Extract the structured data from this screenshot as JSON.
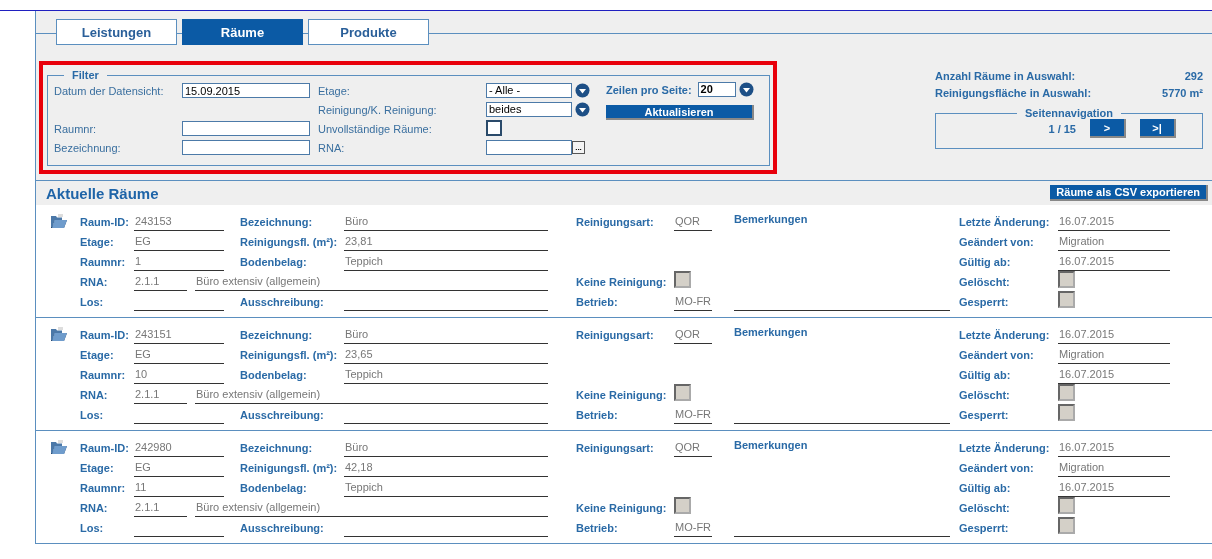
{
  "tabs": [
    {
      "label": "Leistungen",
      "selected": false
    },
    {
      "label": "Räume",
      "selected": true
    },
    {
      "label": "Produkte",
      "selected": false
    }
  ],
  "filter": {
    "legend": "Filter",
    "fields": [
      {
        "kind": "text",
        "label": "Datum der Datensicht:",
        "value": "15.09.2015"
      },
      {
        "kind": "text",
        "label": "Raumnr:"
      },
      {
        "kind": "text",
        "label": "Bezeichnung:"
      },
      {
        "kind": "select",
        "label": "Etage:",
        "value": "- Alle -"
      },
      {
        "kind": "select",
        "label": "Reinigung/K. Reinigung:",
        "value": "beides"
      },
      {
        "kind": "checkbox",
        "label": "Unvollständige Räume:",
        "checked": false
      },
      {
        "kind": "lookup",
        "label": "RNA:",
        "button": "..."
      }
    ],
    "rows_per_page": {
      "label": "Zeilen pro Seite:",
      "value": "20"
    },
    "refresh_button": "Aktualisieren"
  },
  "stats": [
    {
      "label": "Anzahl Räume in Auswahl:",
      "value": "292"
    },
    {
      "label": "Reinigungsfläche in Auswahl:",
      "value": "5770 m²"
    }
  ],
  "pagination": {
    "legend": "Seitennavigation",
    "page": "1 / 15",
    "buttons": [
      ">",
      ">|"
    ]
  },
  "section_title": "Aktuelle Räume",
  "export_button": "Räume als CSV exportieren",
  "records": [
    {
      "remarks": "Bemerkungen",
      "fields": [
        {
          "kind": "text",
          "label": "Raum-ID:",
          "value": "243153"
        },
        {
          "kind": "text",
          "label": "Bezeichnung:",
          "value": "Büro"
        },
        {
          "kind": "text",
          "label": "Reinigungsart:",
          "value": "QOR"
        },
        {
          "kind": "text",
          "label": "Letzte Änderung:",
          "value": "16.07.2015"
        },
        {
          "kind": "text",
          "label": "Etage:",
          "value": "EG"
        },
        {
          "kind": "text",
          "label": "Reinigungsfl. (m²):",
          "value": "23,81"
        },
        {
          "kind": "text",
          "label": "Geändert von:",
          "value": "Migration"
        },
        {
          "kind": "text",
          "label": "Raumnr:",
          "value": "1"
        },
        {
          "kind": "text",
          "label": "Bodenbelag:",
          "value": "Teppich"
        },
        {
          "kind": "text",
          "label": "Gültig ab:",
          "value": "16.07.2015"
        },
        {
          "kind": "rna",
          "label": "RNA:",
          "code": "2.1.1",
          "text": "Büro extensiv (allgemein)"
        },
        {
          "kind": "checkbox",
          "label": "Keine Reinigung:",
          "checked": false
        },
        {
          "kind": "checkbox",
          "label": "Gelöscht:",
          "checked": false
        },
        {
          "kind": "text",
          "label": "Los:"
        },
        {
          "kind": "text",
          "label": "Ausschreibung:"
        },
        {
          "kind": "text",
          "label": "Betrieb:",
          "value": "MO-FR"
        },
        {
          "kind": "checkbox",
          "label": "Gesperrt:",
          "checked": false
        }
      ]
    },
    {
      "remarks": "Bemerkungen",
      "fields": [
        {
          "kind": "text",
          "label": "Raum-ID:",
          "value": "243151"
        },
        {
          "kind": "text",
          "label": "Bezeichnung:",
          "value": "Büro"
        },
        {
          "kind": "text",
          "label": "Reinigungsart:",
          "value": "QOR"
        },
        {
          "kind": "text",
          "label": "Letzte Änderung:",
          "value": "16.07.2015"
        },
        {
          "kind": "text",
          "label": "Etage:",
          "value": "EG"
        },
        {
          "kind": "text",
          "label": "Reinigungsfl. (m²):",
          "value": "23,65"
        },
        {
          "kind": "text",
          "label": "Geändert von:",
          "value": "Migration"
        },
        {
          "kind": "text",
          "label": "Raumnr:",
          "value": "10"
        },
        {
          "kind": "text",
          "label": "Bodenbelag:",
          "value": "Teppich"
        },
        {
          "kind": "text",
          "label": "Gültig ab:",
          "value": "16.07.2015"
        },
        {
          "kind": "rna",
          "label": "RNA:",
          "code": "2.1.1",
          "text": "Büro extensiv (allgemein)"
        },
        {
          "kind": "checkbox",
          "label": "Keine Reinigung:",
          "checked": false
        },
        {
          "kind": "checkbox",
          "label": "Gelöscht:",
          "checked": false
        },
        {
          "kind": "text",
          "label": "Los:"
        },
        {
          "kind": "text",
          "label": "Ausschreibung:"
        },
        {
          "kind": "text",
          "label": "Betrieb:",
          "value": "MO-FR"
        },
        {
          "kind": "checkbox",
          "label": "Gesperrt:",
          "checked": false
        }
      ]
    },
    {
      "remarks": "Bemerkungen",
      "fields": [
        {
          "kind": "text",
          "label": "Raum-ID:",
          "value": "242980"
        },
        {
          "kind": "text",
          "label": "Bezeichnung:",
          "value": "Büro"
        },
        {
          "kind": "text",
          "label": "Reinigungsart:",
          "value": "QOR"
        },
        {
          "kind": "text",
          "label": "Letzte Änderung:",
          "value": "16.07.2015"
        },
        {
          "kind": "text",
          "label": "Etage:",
          "value": "EG"
        },
        {
          "kind": "text",
          "label": "Reinigungsfl. (m²):",
          "value": "42,18"
        },
        {
          "kind": "text",
          "label": "Geändert von:",
          "value": "Migration"
        },
        {
          "kind": "text",
          "label": "Raumnr:",
          "value": "11"
        },
        {
          "kind": "text",
          "label": "Bodenbelag:",
          "value": "Teppich"
        },
        {
          "kind": "text",
          "label": "Gültig ab:",
          "value": "16.07.2015"
        },
        {
          "kind": "rna",
          "label": "RNA:",
          "code": "2.1.1",
          "text": "Büro extensiv (allgemein)"
        },
        {
          "kind": "checkbox",
          "label": "Keine Reinigung:",
          "checked": false
        },
        {
          "kind": "checkbox",
          "label": "Gelöscht:",
          "checked": false
        },
        {
          "kind": "text",
          "label": "Los:"
        },
        {
          "kind": "text",
          "label": "Ausschreibung:"
        },
        {
          "kind": "text",
          "label": "Betrieb:",
          "value": "MO-FR"
        },
        {
          "kind": "checkbox",
          "label": "Gesperrt:",
          "checked": false
        }
      ]
    }
  ]
}
